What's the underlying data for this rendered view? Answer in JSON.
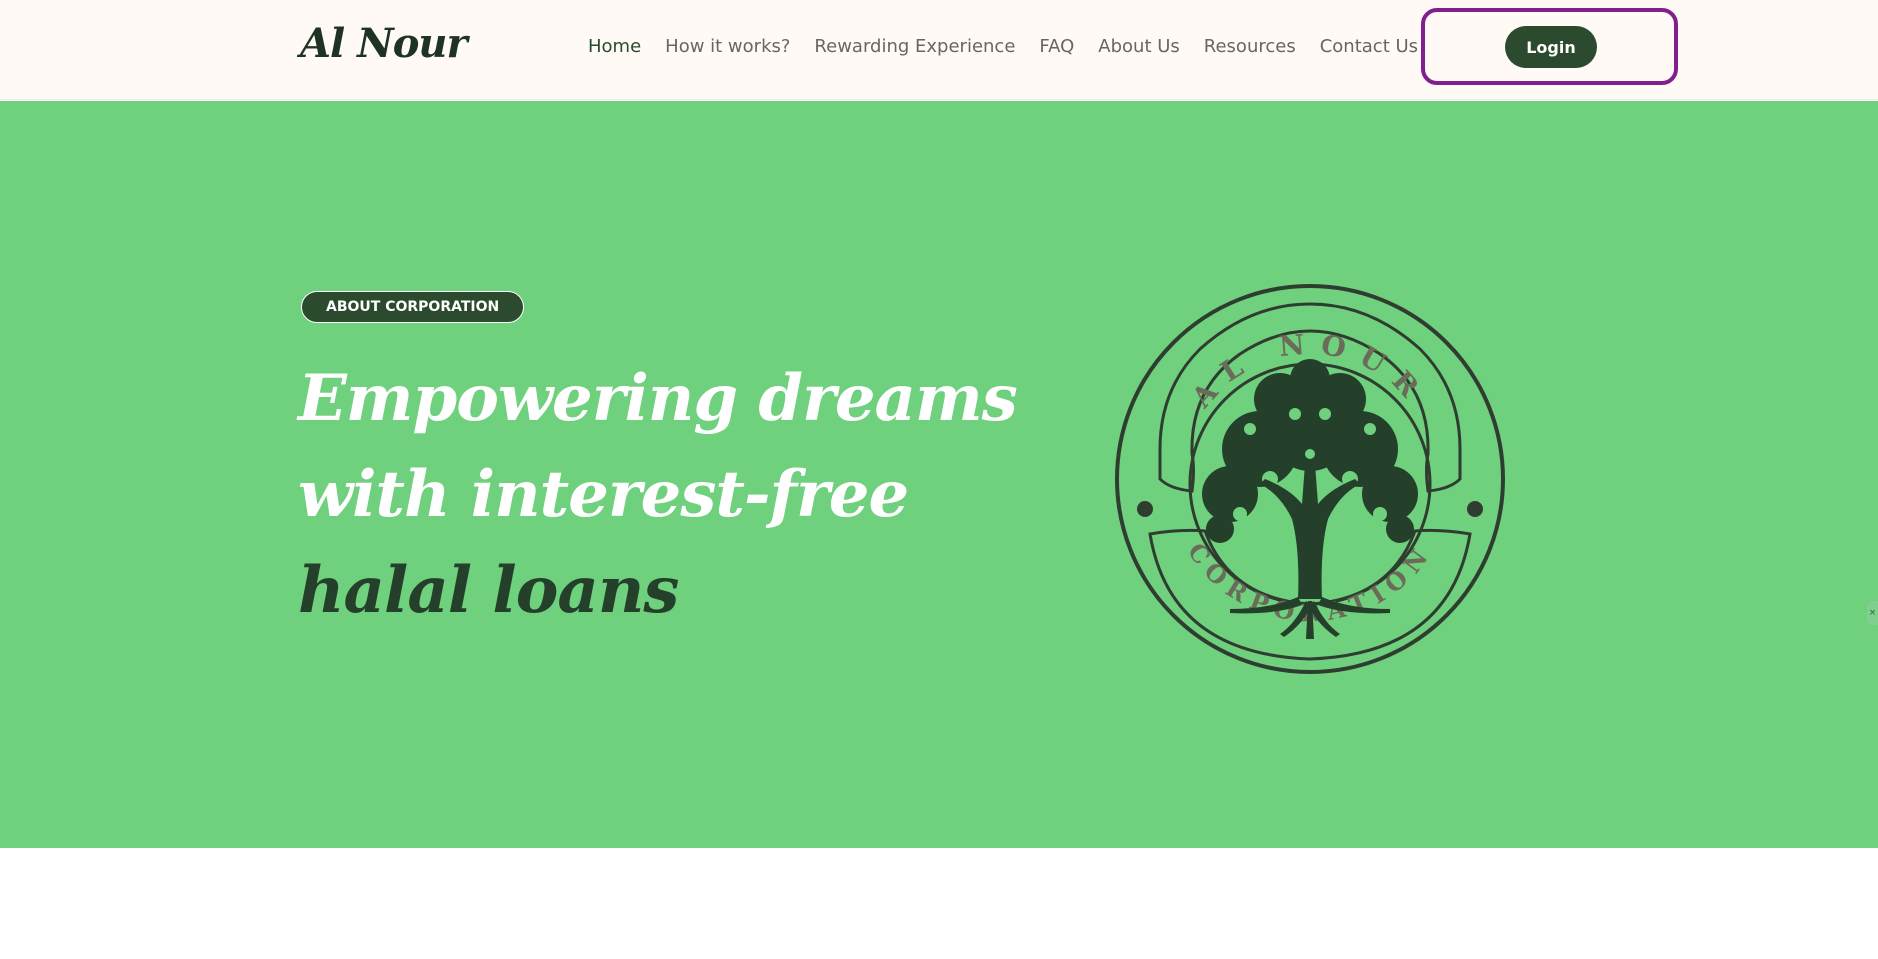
{
  "header": {
    "logo_text": "Al Nour",
    "nav": [
      {
        "label": "Home",
        "active": true
      },
      {
        "label": "How it works?"
      },
      {
        "label": "Rewarding Experience"
      },
      {
        "label": "FAQ"
      },
      {
        "label": "About Us"
      },
      {
        "label": "Resources"
      },
      {
        "label": "Contact Us"
      }
    ],
    "login_label": "Login"
  },
  "hero": {
    "badge": "ABOUT CORPORATION",
    "title_part1": "Empowering dreams with interest-free ",
    "title_highlight": "halal loans",
    "emblem": {
      "top_text": "AL NOUR",
      "bottom_text": "CORPORATION",
      "icon": "tree-icon"
    }
  },
  "colors": {
    "hero_bg": "#6fd07e",
    "dark_green": "#2b4a2e",
    "header_bg": "#fffaf5",
    "highlight_frame": "#821f8f"
  }
}
